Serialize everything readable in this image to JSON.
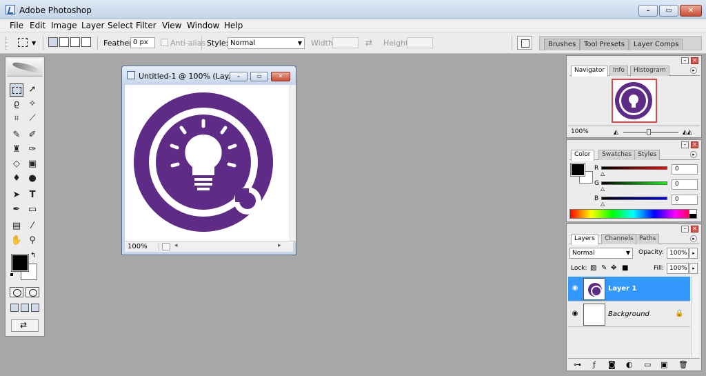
{
  "window": {
    "title": "Adobe Photoshop"
  },
  "menu": [
    "File",
    "Edit",
    "Image",
    "Layer",
    "Select",
    "Filter",
    "View",
    "Window",
    "Help"
  ],
  "options": {
    "feather_label": "Feather:",
    "feather_value": "0 px",
    "antialias_label": "Anti-alias",
    "style_label": "Style:",
    "style_value": "Normal",
    "width_label": "Width:",
    "height_label": "Height:",
    "well_tabs": [
      "Brushes",
      "Tool Presets",
      "Layer Comps"
    ]
  },
  "document": {
    "title": "Untitled-1 @ 100% (Lay...",
    "zoom": "100%",
    "logo_color": "#5e2b86"
  },
  "navigator": {
    "tabs": [
      "Navigator",
      "Info",
      "Histogram"
    ],
    "zoom": "100%"
  },
  "color_panel": {
    "tabs": [
      "Color",
      "Swatches",
      "Styles"
    ],
    "r_label": "R",
    "g_label": "G",
    "b_label": "B",
    "r": "0",
    "g": "0",
    "b": "0"
  },
  "layers_panel": {
    "tabs": [
      "Layers",
      "Channels",
      "Paths"
    ],
    "blend_mode": "Normal",
    "opacity_label": "Opacity:",
    "opacity": "100%",
    "lock_label": "Lock:",
    "fill_label": "Fill:",
    "fill": "100%",
    "layers": [
      {
        "name": "Layer 1",
        "selected": true
      },
      {
        "name": "Background",
        "selected": false
      }
    ]
  },
  "colors": {
    "accent": "#3399ff",
    "logo": "#5e2b86",
    "workspace": "#a7a7a7"
  }
}
